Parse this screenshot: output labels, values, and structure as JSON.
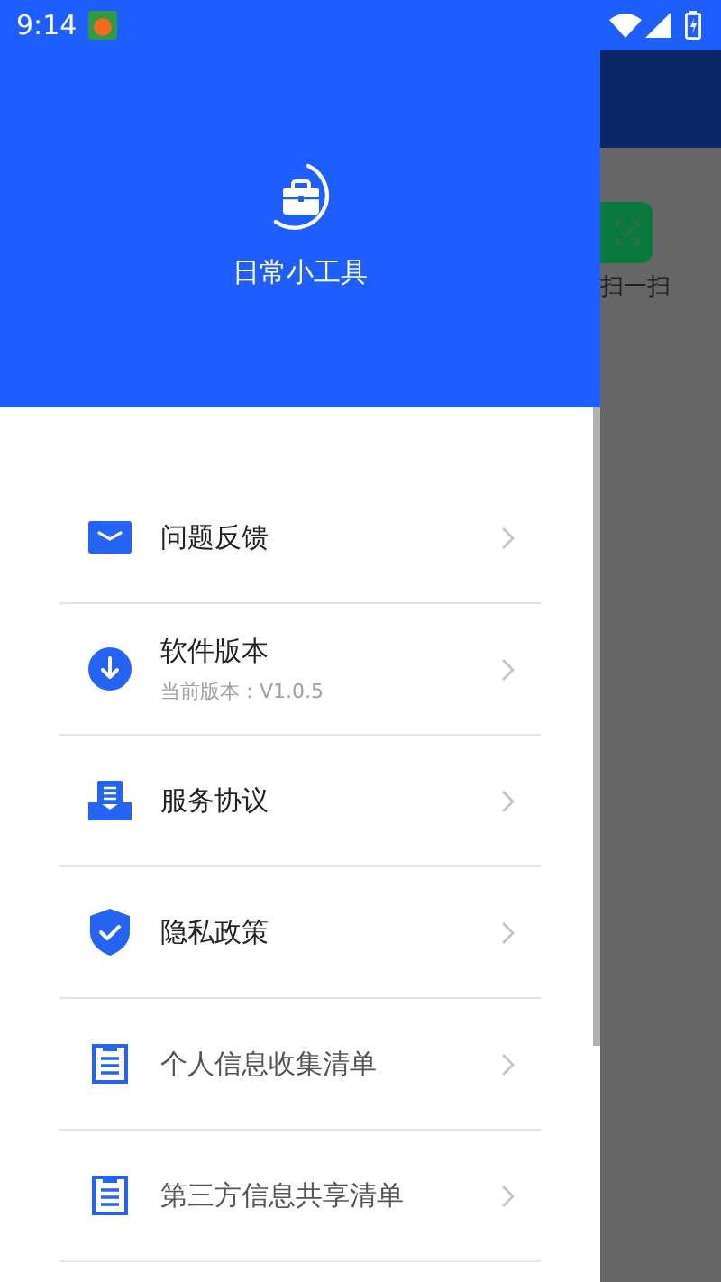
{
  "status_bar": {
    "time": "9:14"
  },
  "drawer": {
    "app_name": "日常小工具",
    "items": [
      {
        "kind": "mail",
        "label": "问题反馈",
        "muted": false
      },
      {
        "kind": "download",
        "label": "软件版本",
        "subtitle": "当前版本：V1.0.5",
        "muted": false
      },
      {
        "kind": "document",
        "label": "服务协议",
        "muted": false
      },
      {
        "kind": "shield",
        "label": "隐私政策",
        "muted": false
      },
      {
        "kind": "list",
        "label": "个人信息收集清单",
        "muted": true
      },
      {
        "kind": "list",
        "label": "第三方信息共享清单",
        "muted": true
      }
    ]
  },
  "background": {
    "shortcut_label": "扫一扫"
  }
}
